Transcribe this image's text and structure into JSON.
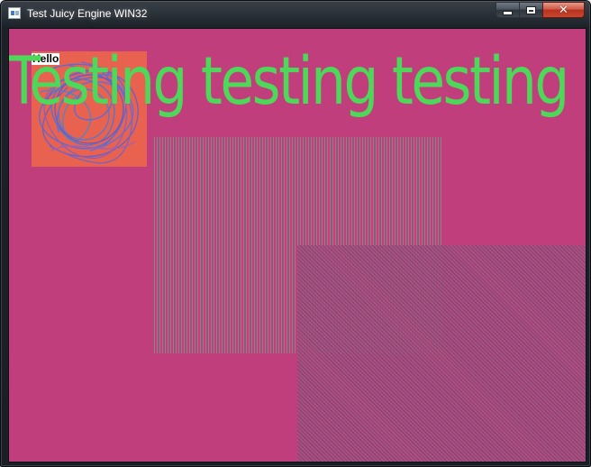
{
  "window": {
    "title": "Test Juicy Engine WIN32",
    "icon": "app-window-icon",
    "controls": {
      "minimize_icon": "minimize-icon",
      "maximize_icon": "maximize-icon",
      "close_icon": "close-icon",
      "close_glyph": "✕"
    }
  },
  "canvas": {
    "background": "#c13e7c",
    "sprite_label": "Hello",
    "headline": "Testing testing testing",
    "headline_color": "#4ed85a",
    "sprite_color": "#e8624f"
  }
}
